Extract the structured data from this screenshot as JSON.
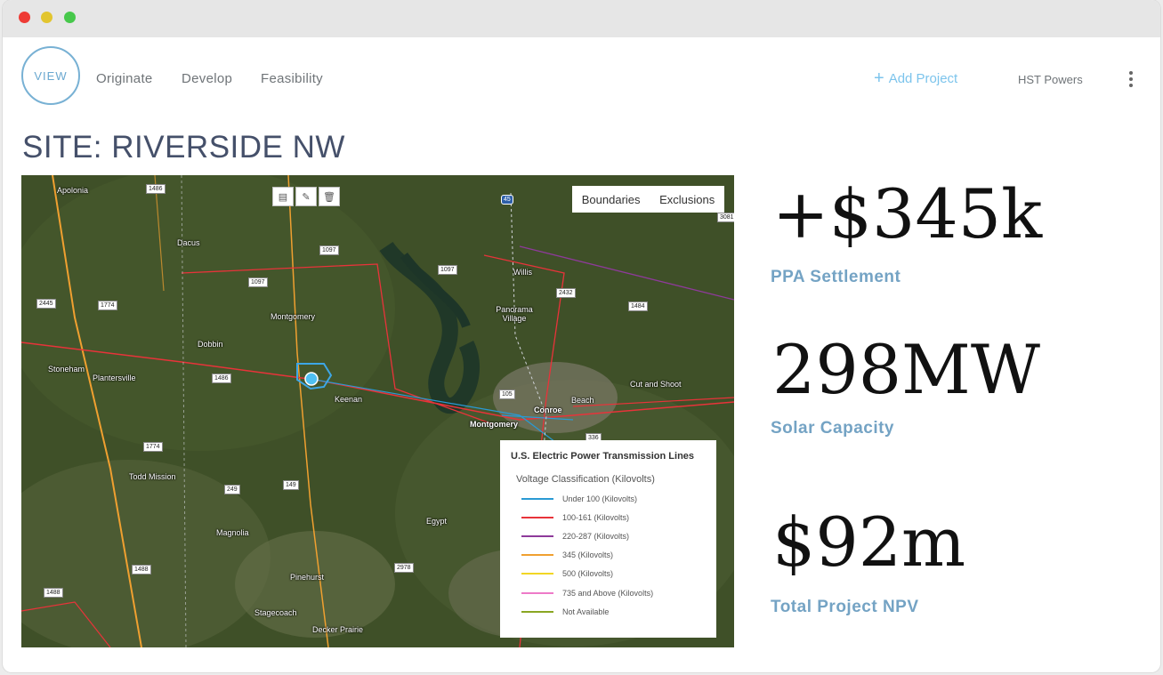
{
  "app": {
    "logo_text": "VIEW",
    "nav": [
      {
        "label": "Originate"
      },
      {
        "label": "Develop"
      },
      {
        "label": "Feasibility"
      }
    ],
    "add_project_label": "Add Project",
    "organization": "HST Powers",
    "icons": {
      "add": "plus-icon",
      "menu": "kebab-menu-icon"
    }
  },
  "page": {
    "title": "SITE: RIVERSIDE NW"
  },
  "map": {
    "tabs": [
      {
        "label": "Boundaries"
      },
      {
        "label": "Exclusions"
      }
    ],
    "tools": [
      "ruler-icon",
      "edit-icon",
      "trash-icon"
    ],
    "place_labels": [
      "Apolonia",
      "Dacus",
      "Montgomery",
      "Dobbin",
      "Stoneham",
      "Plantersville",
      "Keenan",
      "Panorama Village",
      "Willis",
      "Cut and Shoot",
      "Beach",
      "Conroe",
      "Montgomery",
      "Todd Mission",
      "Egypt",
      "Magnolia",
      "Pinehurst",
      "Stagecoach",
      "Decker Prairie"
    ],
    "road_shields": [
      "1486",
      "1097",
      "1097",
      "1097",
      "2445",
      "1774",
      "1486",
      "1774",
      "249",
      "149",
      "105",
      "336",
      "1484",
      "2432",
      "3081",
      "2978",
      "1488",
      "1488",
      "45"
    ],
    "legend": {
      "title": "U.S. Electric Power Transmission Lines",
      "subtitle": "Voltage Classification (Kilovolts)",
      "items": [
        {
          "label": "Under 100 (Kilovolts)",
          "color": "#2a9ad4"
        },
        {
          "label": "100-161 (Kilovolts)",
          "color": "#e8333a"
        },
        {
          "label": "220-287 (Kilovolts)",
          "color": "#8e3a9a"
        },
        {
          "label": "345 (Kilovolts)",
          "color": "#f0a030"
        },
        {
          "label": "500 (Kilovolts)",
          "color": "#f2d624"
        },
        {
          "label": "735 and Above (Kilovolts)",
          "color": "#ee7ac8"
        },
        {
          "label": "Not Available",
          "color": "#8aa622"
        }
      ]
    }
  },
  "kpis": [
    {
      "value": "+$345k",
      "label": "PPA Settlement"
    },
    {
      "value": "298MW",
      "label": "Solar Capacity"
    },
    {
      "value": "$92m",
      "label": "Total Project NPV"
    }
  ]
}
